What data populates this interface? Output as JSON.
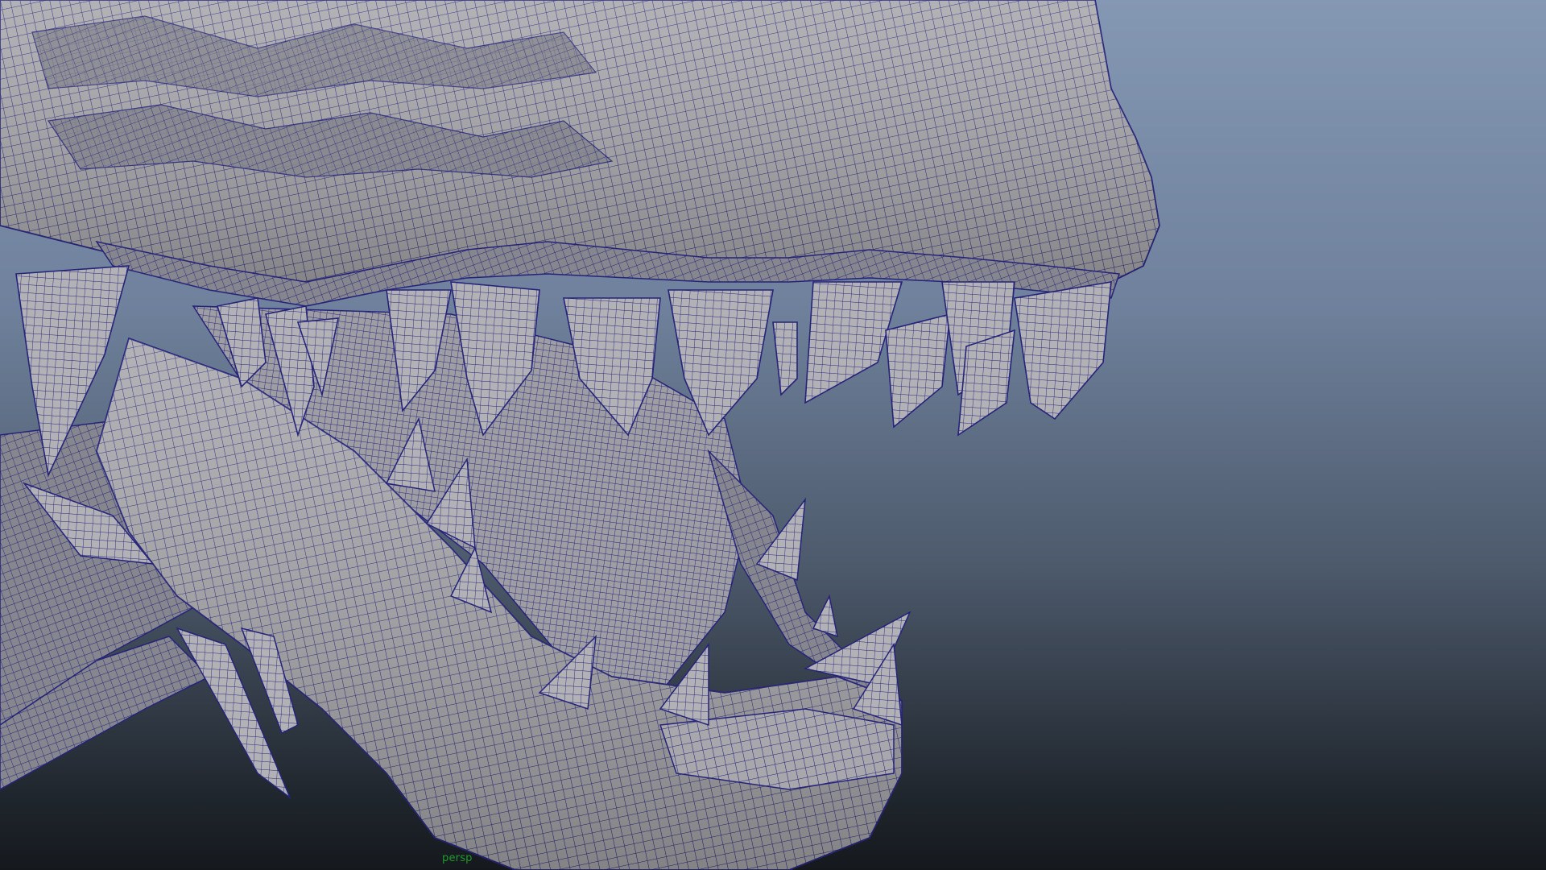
{
  "viewport": {
    "camera_label": "persp",
    "background_top": "#8497b3",
    "background_bottom": "#15191e",
    "mesh_fill": "#a2a2a6",
    "mesh_shadow": "#6d6d74",
    "wire_color": "#25237a"
  },
  "scene": {
    "model": "creature-head-wireframe",
    "parts": [
      "upper-jaw",
      "upper-teeth",
      "lower-jaw",
      "lower-teeth",
      "throat",
      "neck-spikes"
    ]
  }
}
